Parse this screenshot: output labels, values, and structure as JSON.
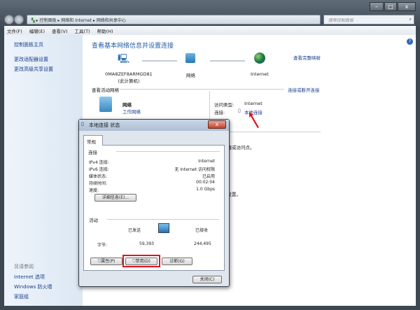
{
  "breadcrumb": [
    "控制面板",
    "网络和 Internet",
    "网络和共享中心"
  ],
  "search_placeholder": "搜索控制面板",
  "menu": [
    "文件(F)",
    "编辑(E)",
    "查看(V)",
    "工具(T)",
    "帮助(H)"
  ],
  "sidebar": {
    "home": "控制面板主页",
    "items": [
      "更改适配器设置",
      "更改高级共享设置"
    ],
    "see_also_title": "另请参阅",
    "see_also": [
      "Internet 选项",
      "Windows 防火墙",
      "家庭组"
    ]
  },
  "main": {
    "title": "查看基本网络信息并设置连接",
    "view_map": "查看完整映射",
    "computer_name": "0MA8ZEF8ARMGD81",
    "computer_sub": "(此计算机)",
    "network_node": "网络",
    "internet_node": "Internet",
    "active_title": "查看活动网络",
    "connect_link": "连接或断开连接",
    "network_name": "网络",
    "network_type": "工作网络",
    "access_label": "访问类型:",
    "access_value": "Internet",
    "conn_label": "连接:",
    "conn_value": "本地连接",
    "partial": [
      "由器或访问点。",
      "题。",
      "享设置。"
    ]
  },
  "dialog": {
    "title": "本地连接 状态",
    "tab": "常规",
    "conn_section": "连接",
    "rows": [
      {
        "label": "IPv4 连接:",
        "value": "Internet"
      },
      {
        "label": "IPv6 连接:",
        "value": "无 Internet 访问权限"
      },
      {
        "label": "媒体状态:",
        "value": "已启用"
      },
      {
        "label": "持续时间:",
        "value": "00:02:04"
      },
      {
        "label": "速度:",
        "value": "1.0 Gbps"
      }
    ],
    "details_btn": "详细信息(E)...",
    "activity_section": "活动",
    "sent_label": "已发送",
    "recv_label": "已接收",
    "bytes_label": "字节:",
    "sent": "59,393",
    "recv": "244,495",
    "props_btn": "属性(P)",
    "disable_btn": "禁用(D)",
    "diagnose_btn": "诊断(G)",
    "close_btn": "关闭(C)"
  },
  "colors": {
    "highlight": "#e0141e",
    "link": "#1f5fa8"
  }
}
